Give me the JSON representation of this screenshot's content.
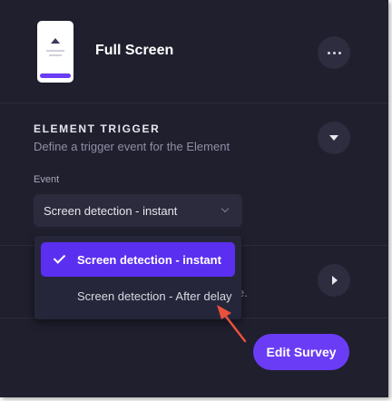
{
  "header": {
    "title": "Full Screen",
    "more_icon": "more-horizontal-icon"
  },
  "element_trigger": {
    "heading": "ELEMENT TRIGGER",
    "subtitle": "Define a trigger event for the Element",
    "toggle_icon": "caret-down-icon",
    "event_label": "Event",
    "selected_value": "Screen detection - instant",
    "options": [
      {
        "label": "Screen detection - instant",
        "selected": true
      },
      {
        "label": "Screen detection - After delay",
        "selected": false
      }
    ]
  },
  "collapsed_section": {
    "partial_text": "e.",
    "toggle_icon": "caret-right-icon"
  },
  "footer": {
    "edit_label": "Edit Survey"
  },
  "colors": {
    "panel_bg": "#1f1f2e",
    "accent": "#6a3cf5",
    "annotation_arrow": "#e8513c"
  }
}
